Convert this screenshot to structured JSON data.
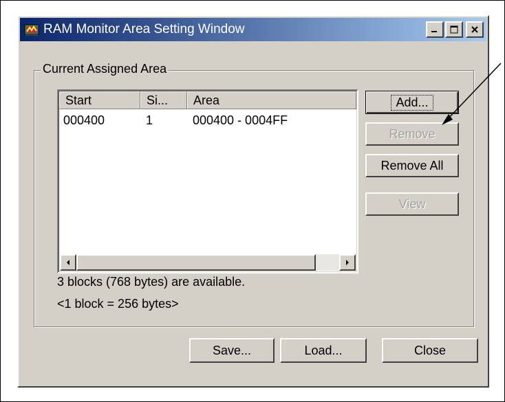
{
  "window": {
    "title": "RAM Monitor Area Setting Window"
  },
  "group": {
    "label": "Current Assigned Area"
  },
  "list": {
    "columns": [
      "Start",
      "Si...",
      "Area"
    ],
    "rows": [
      {
        "start": "000400",
        "size": "1",
        "area": "000400 - 0004FF"
      }
    ]
  },
  "buttons": {
    "add": "Add...",
    "remove": "Remove",
    "remove_all": "Remove All",
    "view": "View",
    "save": "Save...",
    "load": "Load...",
    "close": "Close"
  },
  "info": {
    "line1": "3 blocks (768 bytes) are available.",
    "line2": "<1 block = 256 bytes>"
  },
  "icons": {
    "app": "ram-monitor-app-icon",
    "minimize": "minimize-icon",
    "maximize": "maximize-icon",
    "close": "close-icon",
    "scroll_left": "scroll-left-arrow-icon",
    "scroll_right": "scroll-right-arrow-icon"
  },
  "colors": {
    "title_start": "#0a246a",
    "title_end": "#a6caf0",
    "face": "#d4d0c8"
  }
}
